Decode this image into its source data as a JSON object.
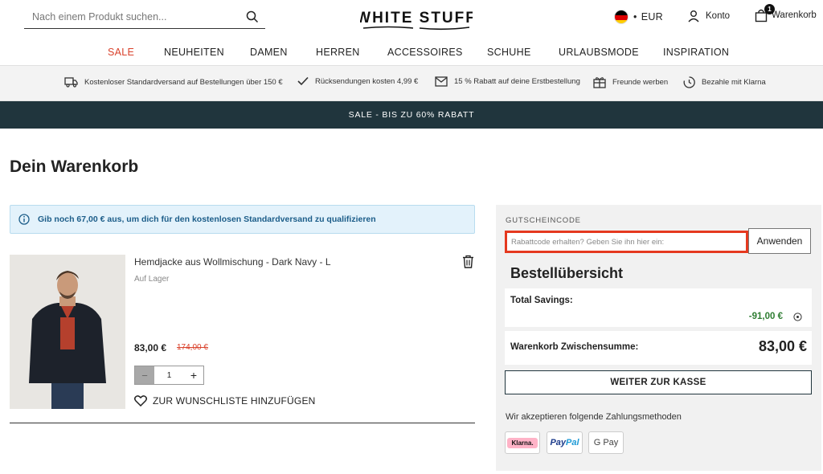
{
  "header": {
    "search_placeholder": "Nach einem Produkt suchen...",
    "logo_text": "WHITE STUFF",
    "currency": "EUR",
    "currency_separator": "•",
    "account_label": "Konto",
    "cart_label": "Warenkorb",
    "cart_count": "1"
  },
  "nav": {
    "items": [
      "SALE",
      "NEUHEITEN",
      "DAMEN",
      "HERREN",
      "ACCESSOIRES",
      "SCHUHE",
      "URLAUBSMODE",
      "INSPIRATION"
    ]
  },
  "usp": {
    "items": [
      {
        "icon": "truck-icon",
        "label": "Kostenloser Standardversand auf Bestellungen über 150 €"
      },
      {
        "icon": "check-icon",
        "label": "Rücksendungen kosten 4,99 €"
      },
      {
        "icon": "envelope-icon",
        "label": "15 % Rabatt auf deine Erstbestellung"
      },
      {
        "icon": "gift-icon",
        "label": "Freunde werben"
      },
      {
        "icon": "clock-icon",
        "label": "Bezahle mit Klarna"
      }
    ]
  },
  "promo": {
    "text": "SALE - BIS ZU 60% RABATT"
  },
  "page": {
    "title": "Dein Warenkorb"
  },
  "info_banner": {
    "text": "Gib noch 67,00 € aus, um dich für den kostenlosen Standardversand zu qualifizieren"
  },
  "cart_item": {
    "name": "Hemdjacke aus Wollmischung - Dark Navy - L",
    "stock": "Auf Lager",
    "price": "83,00 €",
    "old_price": "174,00 €",
    "quantity": "1",
    "minus": "−",
    "plus": "+",
    "wishlist_label": "ZUR WUNSCHLISTE HINZUFÜGEN"
  },
  "summary": {
    "voucher_label": "GUTSCHEINCODE",
    "voucher_placeholder": "Rabattcode erhalten? Geben Sie ihn hier ein:",
    "apply_label": "Anwenden",
    "overview_title": "Bestellübersicht",
    "savings_label": "Total Savings:",
    "savings_value": "-91,00 €",
    "subtotal_label": "Warenkorb Zwischensumme:",
    "subtotal_value": "83,00 €",
    "checkout_label": "WEITER ZUR KASSE",
    "payment_label": "Wir akzeptieren folgende Zahlungsmethoden",
    "payment_methods": [
      "Klarna.",
      "PayPal",
      "G Pay"
    ]
  },
  "colors": {
    "accent_red": "#d9412b",
    "promo_bg": "#20353d",
    "highlight": "#e5391f",
    "savings_green": "#2e7d32"
  }
}
